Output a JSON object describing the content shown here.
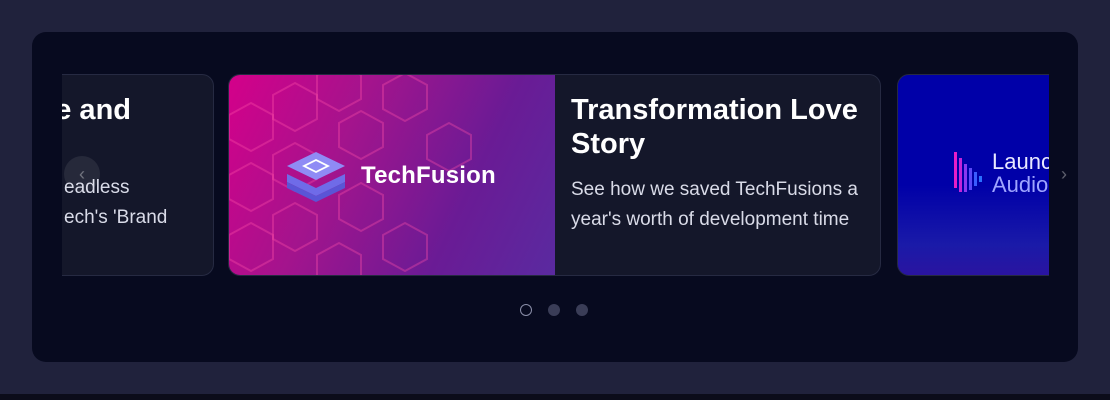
{
  "carousel": {
    "slides": [
      {
        "title_fragment": "e and",
        "desc_lines": [
          "eadless",
          "ech's 'Brand"
        ]
      },
      {
        "brand": "TechFusion",
        "title": "Transformation Love Story",
        "description": "See how we saved TechFusions a year's worth of development time"
      },
      {
        "brand_line1": "Launc",
        "brand_line2": "Audio"
      }
    ],
    "icons": {
      "prev": "chevron-left-icon",
      "next": "chevron-right-icon",
      "techfusion_logo": "stacked-layers-icon",
      "launch_logo": "audio-bars-icon"
    },
    "pagination": {
      "count": 3,
      "active_index": 0
    },
    "colors": {
      "page_bg": "#20223c",
      "panel_bg": "#070a1f",
      "card_bg": "#14172a",
      "accent_magenta": "#d4008a",
      "accent_purple": "#5a2aa0",
      "launch_blue": "#0000a8"
    }
  }
}
